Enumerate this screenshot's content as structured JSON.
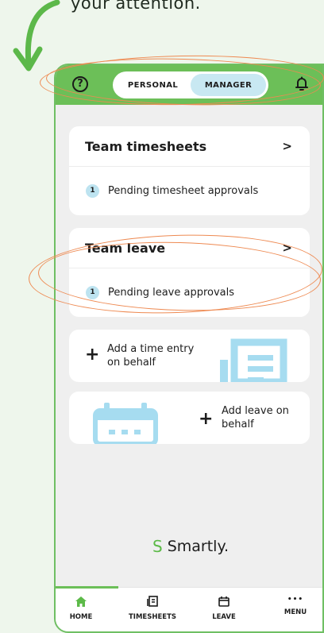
{
  "caption": "your attention.",
  "header": {
    "help_icon": "question-circle-icon",
    "toggle": {
      "personal": "PERSONAL",
      "manager": "MANAGER",
      "selected": "MANAGER"
    },
    "bell_icon": "bell-icon"
  },
  "team_timesheets": {
    "title": "Team timesheets",
    "chevron": ">",
    "pending_count": "1",
    "pending_label": "Pending timesheet approvals"
  },
  "team_leave": {
    "title": "Team leave",
    "chevron": ">",
    "pending_count": "1",
    "pending_label": "Pending leave approvals"
  },
  "actions": {
    "add_time_plus": "+",
    "add_time_line1": "Add a time entry",
    "add_time_line2": "on behalf",
    "add_leave_plus": "+",
    "add_leave_line1": "Add leave on",
    "add_leave_line2": "behalf"
  },
  "brand": {
    "name": "Smartly.",
    "mark": "S"
  },
  "tabbar": {
    "home": "HOME",
    "timesheets": "TIMESHEETS",
    "leave": "LEAVE",
    "menu_glyph": "•••",
    "menu": "MENU",
    "active": "HOME"
  },
  "colors": {
    "brand_green": "#6cbf58",
    "highlight_orange": "#ee8a52",
    "toggle_active": "#c8e8f2",
    "badge": "#bde3f0",
    "illustration_blue": "#a6dcf0"
  }
}
